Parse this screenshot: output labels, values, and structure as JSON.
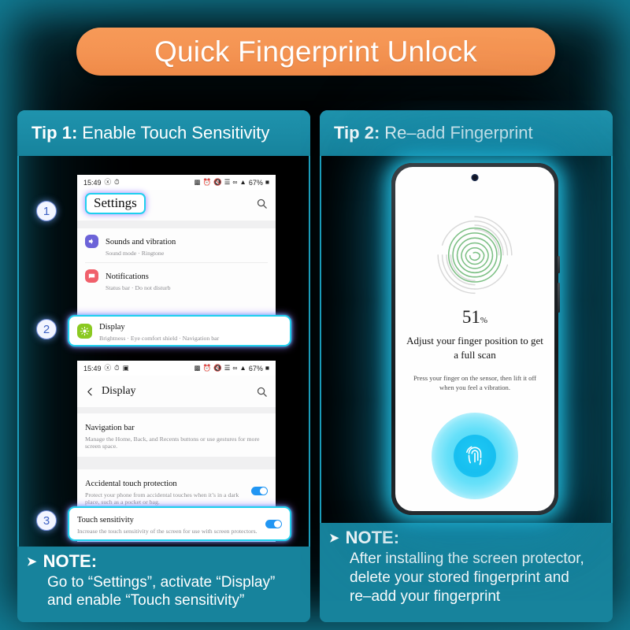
{
  "banner": {
    "title": "Quick Fingerprint Unlock"
  },
  "theme": {
    "accent_orange": "#f4924f",
    "panel_teal": "#17839c",
    "border_cyan": "#1c9fbd",
    "glow_cyan": "#24c8eb",
    "toggle_blue": "#2196f3"
  },
  "panels": {
    "left": {
      "header_label": "Tip 1:",
      "header_rest": "Enable Touch Sensitivity",
      "note": {
        "arrow": "➤",
        "title": "NOTE:",
        "line1": "Go to “Settings”, activate “Display”",
        "line2": "and enable “Touch sensitivity”"
      },
      "steps": [
        {
          "number": "1"
        },
        {
          "number": "2"
        },
        {
          "number": "3"
        }
      ],
      "shot1": {
        "statusbar": {
          "time": "15:49",
          "left_icons": [
            "mute-icon",
            "alarm-icon"
          ],
          "right_icons": [
            "signal-bars-icon",
            "alarm-icon",
            "mute-icon",
            "wifi-icon",
            "link-icon",
            "network-icon"
          ],
          "battery": "67%"
        },
        "screen_title": "Settings",
        "search_icon": "search-icon",
        "rows": [
          {
            "icon": "volume-icon",
            "icon_color": "#6c63d8",
            "title": "Sounds and vibration",
            "subtitle": "Sound mode  ·  Ringtone"
          },
          {
            "icon": "notification-icon",
            "icon_color": "#f0606b",
            "title": "Notifications",
            "subtitle": "Status bar  ·  Do not disturb"
          }
        ],
        "callout": {
          "icon": "brightness-icon",
          "icon_color": "#8bc921",
          "title": "Display",
          "subtitle": "Brightness  ·  Eye comfort shield  ·  Navigation bar"
        }
      },
      "shot2": {
        "statusbar": {
          "time": "15:49",
          "battery": "67%"
        },
        "back_icon": "chevron-left-icon",
        "screen_title": "Display",
        "search_icon": "search-icon",
        "rows": [
          {
            "title": "Navigation bar",
            "subtitle": "Manage the Home, Back, and Recents buttons or use gestures for more screen space.",
            "toggle": false
          },
          {
            "title": "Accidental touch protection",
            "subtitle": "Protect your phone from accidental touches when it’s in a dark place, such as a pocket or bag.",
            "toggle": true
          }
        ],
        "callout": {
          "title": "Touch sensitivity",
          "subtitle": "Increase the touch sensitivity of the screen for use with screen protectors.",
          "toggle": true
        }
      }
    },
    "right": {
      "header_label": "Tip 2:",
      "header_rest": "Re–add Fingerprint",
      "note": {
        "arrow": "➤",
        "title": "NOTE:",
        "line1": "After installing the screen protector,",
        "line2": "delete your stored fingerprint and",
        "line3": "re–add your fingerprint"
      },
      "phone": {
        "camera_icon": "front-camera-icon",
        "fingerprint_graphic": "fingerprint-icon",
        "percent_value": "51",
        "percent_symbol": "%",
        "headline": "Adjust your finger position to get a full scan",
        "subtext": "Press your finger on the sensor, then lift it off when you feel a vibration.",
        "sensor_icon": "fingerprint-sensor-icon"
      }
    }
  }
}
